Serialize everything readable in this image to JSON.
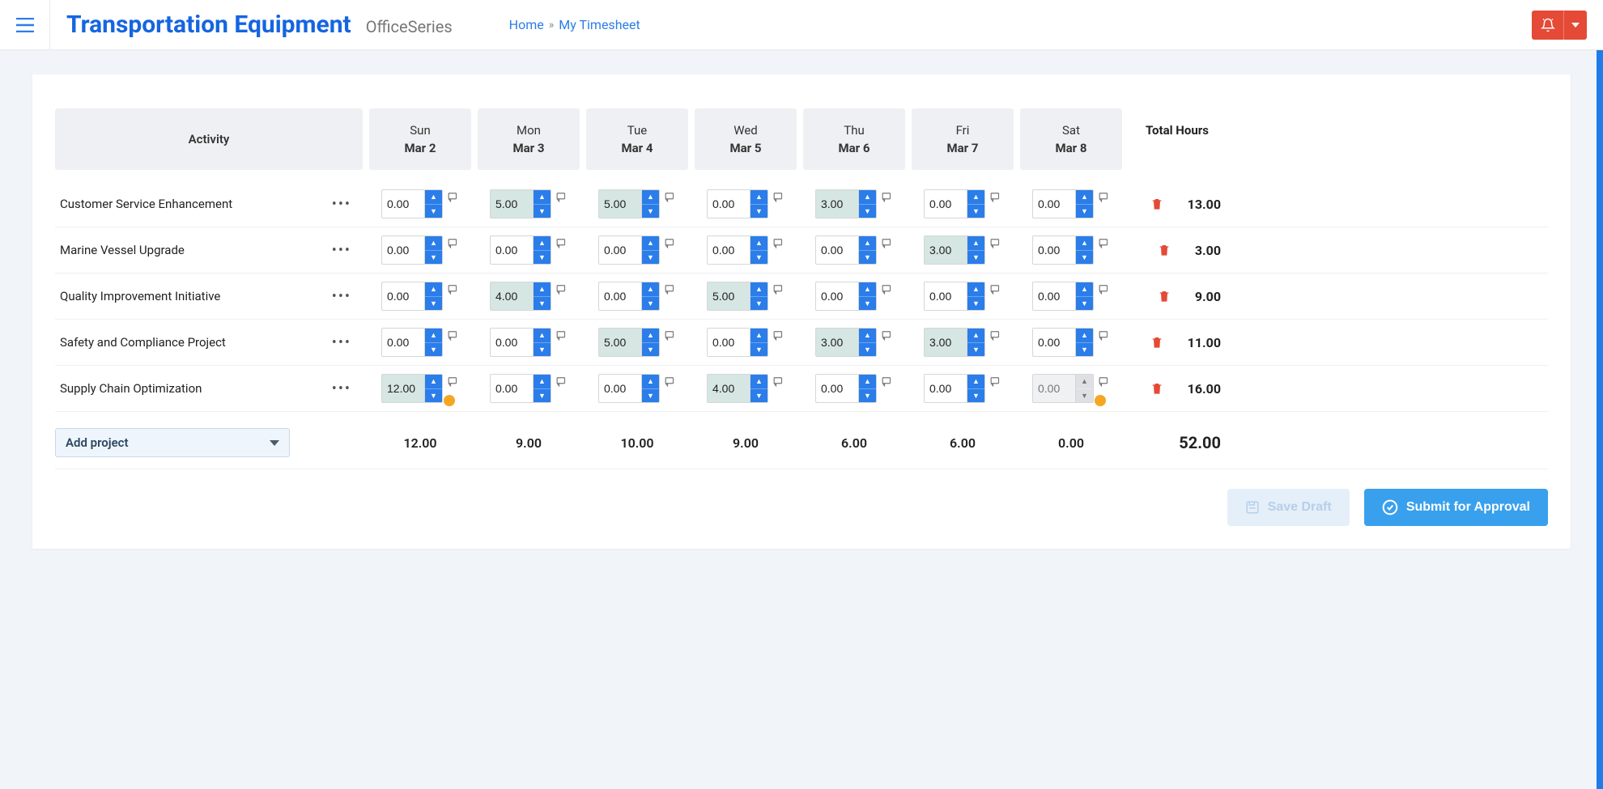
{
  "brand": {
    "title": "Transportation Equipment",
    "subtitle": "OfficeSeries"
  },
  "breadcrumb": {
    "home": "Home",
    "current": "My Timesheet"
  },
  "headers": {
    "activity": "Activity",
    "total": "Total Hours"
  },
  "days": [
    {
      "dow": "Sun",
      "date": "Mar 2"
    },
    {
      "dow": "Mon",
      "date": "Mar 3"
    },
    {
      "dow": "Tue",
      "date": "Mar 4"
    },
    {
      "dow": "Wed",
      "date": "Mar 5"
    },
    {
      "dow": "Thu",
      "date": "Mar 6"
    },
    {
      "dow": "Fri",
      "date": "Mar 7"
    },
    {
      "dow": "Sat",
      "date": "Mar 8"
    }
  ],
  "activities": [
    {
      "name": "Customer Service Enhancement",
      "hours": [
        "0.00",
        "5.00",
        "5.00",
        "0.00",
        "3.00",
        "0.00",
        "0.00"
      ],
      "filled": [
        false,
        true,
        true,
        false,
        true,
        false,
        false
      ],
      "warn": [
        false,
        false,
        false,
        false,
        false,
        false,
        false
      ],
      "hover": [
        false,
        false,
        false,
        false,
        false,
        false,
        false
      ],
      "total": "13.00"
    },
    {
      "name": "Marine Vessel Upgrade",
      "hours": [
        "0.00",
        "0.00",
        "0.00",
        "0.00",
        "0.00",
        "3.00",
        "0.00"
      ],
      "filled": [
        false,
        false,
        false,
        false,
        false,
        true,
        false
      ],
      "warn": [
        false,
        false,
        false,
        false,
        false,
        false,
        false
      ],
      "hover": [
        false,
        false,
        false,
        false,
        false,
        false,
        false
      ],
      "total": "3.00"
    },
    {
      "name": "Quality Improvement Initiative",
      "hours": [
        "0.00",
        "4.00",
        "0.00",
        "5.00",
        "0.00",
        "0.00",
        "0.00"
      ],
      "filled": [
        false,
        true,
        false,
        true,
        false,
        false,
        false
      ],
      "warn": [
        false,
        false,
        false,
        false,
        false,
        false,
        false
      ],
      "hover": [
        false,
        false,
        false,
        false,
        false,
        false,
        false
      ],
      "total": "9.00"
    },
    {
      "name": "Safety and Compliance Project",
      "hours": [
        "0.00",
        "0.00",
        "5.00",
        "0.00",
        "3.00",
        "3.00",
        "0.00"
      ],
      "filled": [
        false,
        false,
        true,
        false,
        true,
        true,
        false
      ],
      "warn": [
        false,
        false,
        false,
        false,
        false,
        false,
        false
      ],
      "hover": [
        false,
        false,
        false,
        false,
        false,
        false,
        false
      ],
      "total": "11.00"
    },
    {
      "name": "Supply Chain Optimization",
      "hours": [
        "12.00",
        "0.00",
        "0.00",
        "4.00",
        "0.00",
        "0.00",
        "0.00"
      ],
      "filled": [
        true,
        false,
        false,
        true,
        false,
        false,
        false
      ],
      "warn": [
        true,
        false,
        false,
        false,
        false,
        false,
        true
      ],
      "hover": [
        false,
        false,
        false,
        false,
        false,
        false,
        true
      ],
      "total": "16.00"
    }
  ],
  "day_totals": [
    "12.00",
    "9.00",
    "10.00",
    "9.00",
    "6.00",
    "6.00",
    "0.00"
  ],
  "grand_total": "52.00",
  "add_project_label": "Add project",
  "buttons": {
    "save_draft": "Save Draft",
    "submit": "Submit for Approval"
  }
}
